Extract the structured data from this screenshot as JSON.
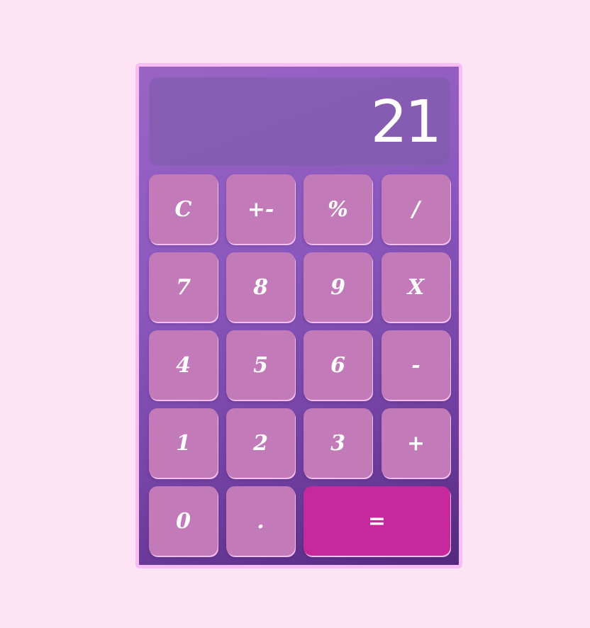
{
  "display": {
    "value": "21"
  },
  "keys": {
    "clear": "C",
    "negate": "+-",
    "percent": "%",
    "divide": "/",
    "seven": "7",
    "eight": "8",
    "nine": "9",
    "multiply": "X",
    "four": "4",
    "five": "5",
    "six": "6",
    "subtract": "-",
    "one": "1",
    "two": "2",
    "three": "3",
    "add": "+",
    "zero": "0",
    "decimal": ".",
    "equals": "="
  },
  "colors": {
    "page_background": "#fde3f3",
    "calculator_border": "#f8bdf2",
    "key": "#c27ab8",
    "equals_key": "#c7289c",
    "text": "#ffffff"
  }
}
